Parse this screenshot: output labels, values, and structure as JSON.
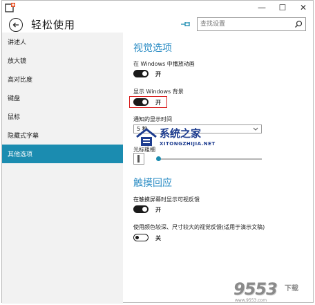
{
  "window": {
    "buttons": {
      "minimize": "—",
      "maximize": "☐",
      "close": "✕"
    }
  },
  "header": {
    "title": "轻松使用",
    "search_placeholder": "查找设置"
  },
  "sidebar": {
    "items": [
      {
        "label": "讲述人",
        "active": false
      },
      {
        "label": "放大镜",
        "active": false
      },
      {
        "label": "高对比度",
        "active": false
      },
      {
        "label": "键盘",
        "active": false
      },
      {
        "label": "鼠标",
        "active": false
      },
      {
        "label": "隐藏式字幕",
        "active": false
      },
      {
        "label": "其他选项",
        "active": true
      }
    ]
  },
  "visual": {
    "title": "视觉选项",
    "anim_label": "在 Windows 中播放动画",
    "anim_state": "开",
    "bg_label": "显示 Windows 背景",
    "bg_state": "开",
    "notify_label": "通知的显示时间",
    "notify_value": "5 秒",
    "cursor_label": "光标粗细"
  },
  "touch": {
    "title": "触摸回应",
    "feedback_label": "在触摸屏幕时显示可视反馈",
    "feedback_state": "开",
    "dark_label": "使用颜色较深、尺寸较大的视觉反馈(适用于演示文稿)",
    "dark_state": "关"
  },
  "watermark": {
    "title": "系统之家",
    "url": "XITONGZHIJIA.NET"
  },
  "corner_watermark": {
    "number": "9553",
    "sub": "下载",
    "url": "www.9553.com"
  },
  "colors": {
    "accent": "#1b8cb0",
    "section_title": "#2b8cc4",
    "highlight": "#d81e1e"
  },
  "icons": [
    "app-icon",
    "back-arrow-icon",
    "pin-icon",
    "search-icon",
    "chevron-down-icon"
  ]
}
